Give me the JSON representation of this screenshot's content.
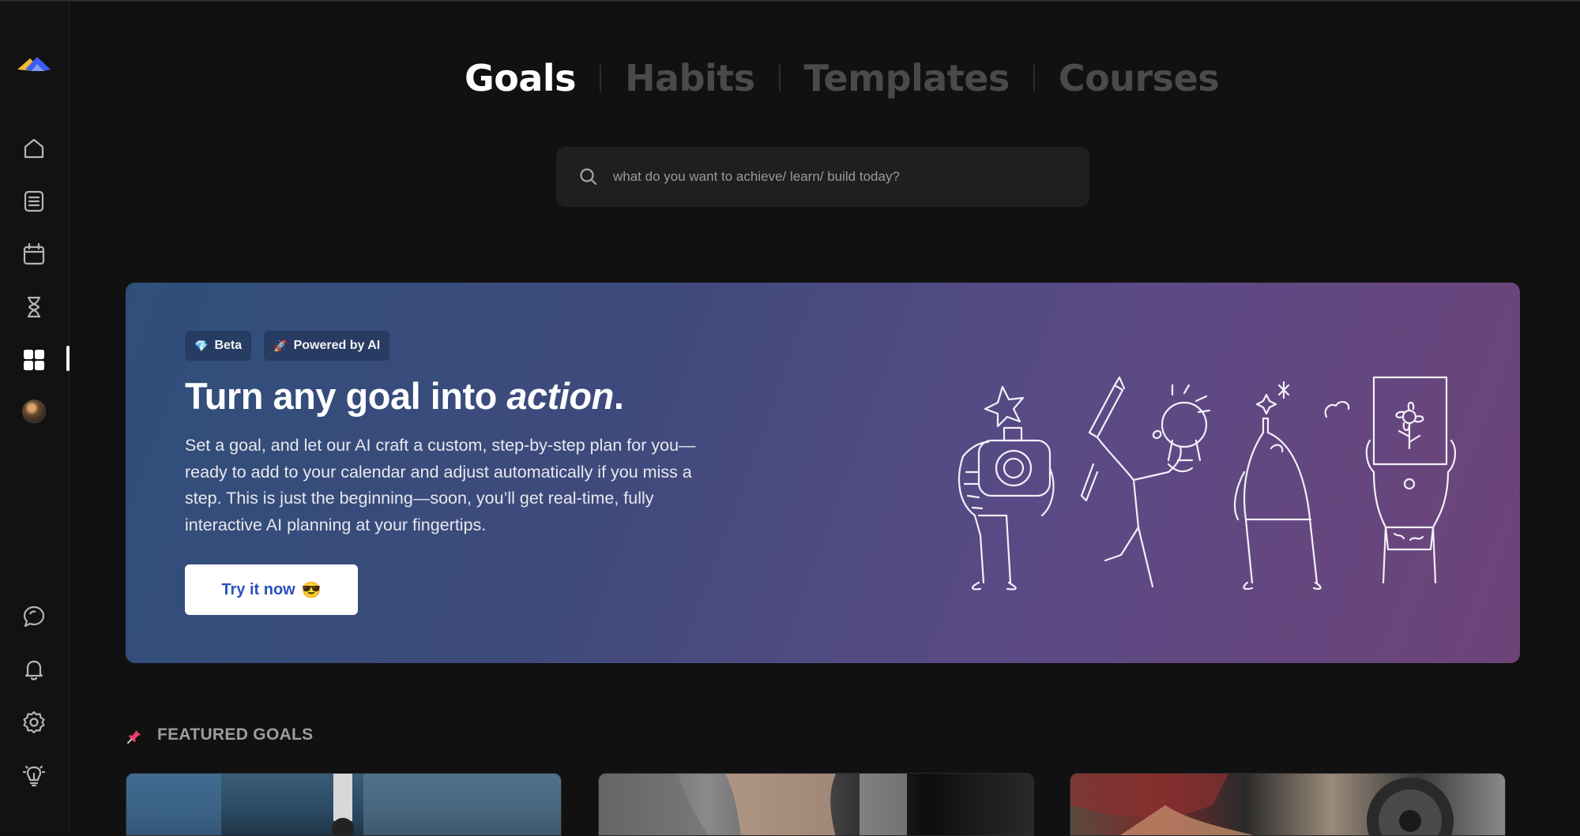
{
  "tabs": [
    {
      "label": "Goals",
      "active": true
    },
    {
      "label": "Habits",
      "active": false
    },
    {
      "label": "Templates",
      "active": false
    },
    {
      "label": "Courses",
      "active": false
    }
  ],
  "search": {
    "placeholder": "what do you want to achieve/ learn/ build today?",
    "value": ""
  },
  "sidebar": {
    "logo": "app-logo",
    "items": [
      {
        "name": "home-icon"
      },
      {
        "name": "notes-icon"
      },
      {
        "name": "calendar-icon"
      },
      {
        "name": "hourglass-icon"
      },
      {
        "name": "grid-icon",
        "active": true
      },
      {
        "name": "avatar"
      }
    ],
    "bottom_items": [
      {
        "name": "chat-icon"
      },
      {
        "name": "bell-icon"
      },
      {
        "name": "gear-icon"
      },
      {
        "name": "lightbulb-icon"
      }
    ]
  },
  "hero": {
    "badges": [
      {
        "icon": "💎",
        "label": "Beta"
      },
      {
        "icon": "🚀",
        "label": "Powered by AI"
      }
    ],
    "title_prefix": "Turn any goal into ",
    "title_emphasis": "action",
    "title_suffix": ".",
    "description": "Set a goal, and let our AI craft a custom, step-by-step plan for you—ready to add to your calendar and adjust automatically if you miss a step. This is just the beginning—soon, you’ll get real-time, fully interactive AI planning at your fingertips.",
    "cta_label": "Try it now",
    "cta_emoji": "😎"
  },
  "featured": {
    "label": "FEATURED GOALS",
    "icon": "📌"
  },
  "colors": {
    "background": "#111111",
    "hero_gradient_start": "#2f4f7a",
    "hero_gradient_end": "#6e4478",
    "cta_text": "#2b4fc0",
    "logo_blue": "#3a5cf0",
    "logo_yellow": "#f2b933"
  }
}
